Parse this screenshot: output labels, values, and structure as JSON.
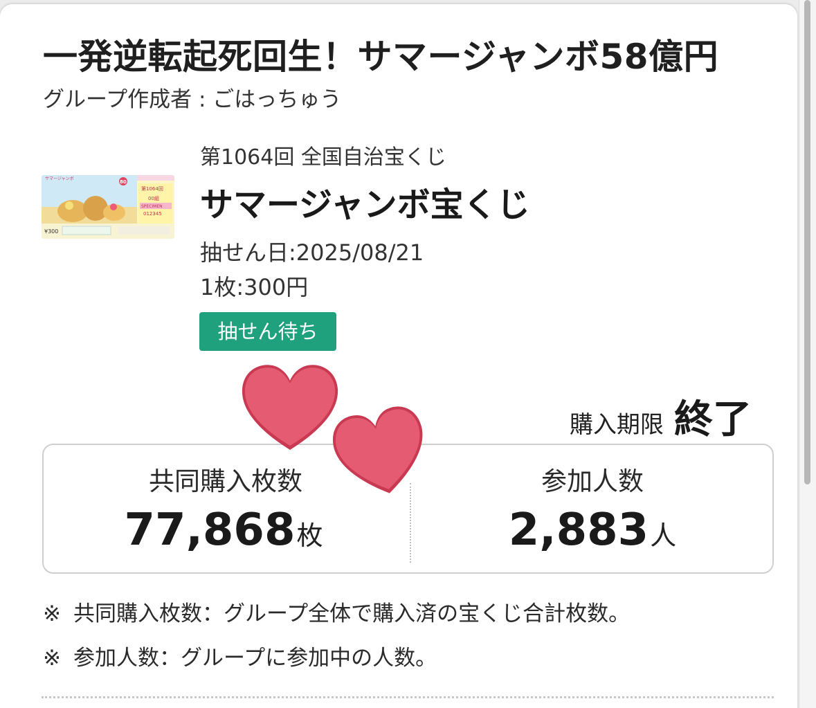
{
  "group": {
    "title": "一発逆転起死回生！サマージャンボ58億円",
    "creator": "グループ作成者 : ごはっちゅう"
  },
  "lottery": {
    "draw_number": "第1064回 全国自治宝くじ",
    "name": "サマージャンボ宝くじ",
    "draw_date": "抽せん日:2025/08/21",
    "price": "1枚:300円",
    "status": "抽せん待ち",
    "status_color": "#1fa17d",
    "ticket_image": {
      "header": "サマージャンボ",
      "badge": "80",
      "number_label": "第1064回",
      "group_label": "00組",
      "specimen": "SPECIMEN",
      "serial": "012345",
      "price_tag": "¥300"
    }
  },
  "deadline": {
    "label": "購入期限",
    "value": "終了"
  },
  "stats": {
    "purchased": {
      "label": "共同購入枚数",
      "value": "77,868",
      "unit": "枚"
    },
    "participants": {
      "label": "参加人数",
      "value": "2,883",
      "unit": "人"
    }
  },
  "notes": [
    {
      "mark": "※",
      "text": "共同購入枚数：グループ全体で購入済の宝くじ合計枚数。"
    },
    {
      "mark": "※",
      "text": "参加人数：グループに参加中の人数。"
    }
  ],
  "decorations": {
    "heart_color": "#e55c72",
    "heart_icons": [
      "heart-icon",
      "heart-icon"
    ]
  }
}
